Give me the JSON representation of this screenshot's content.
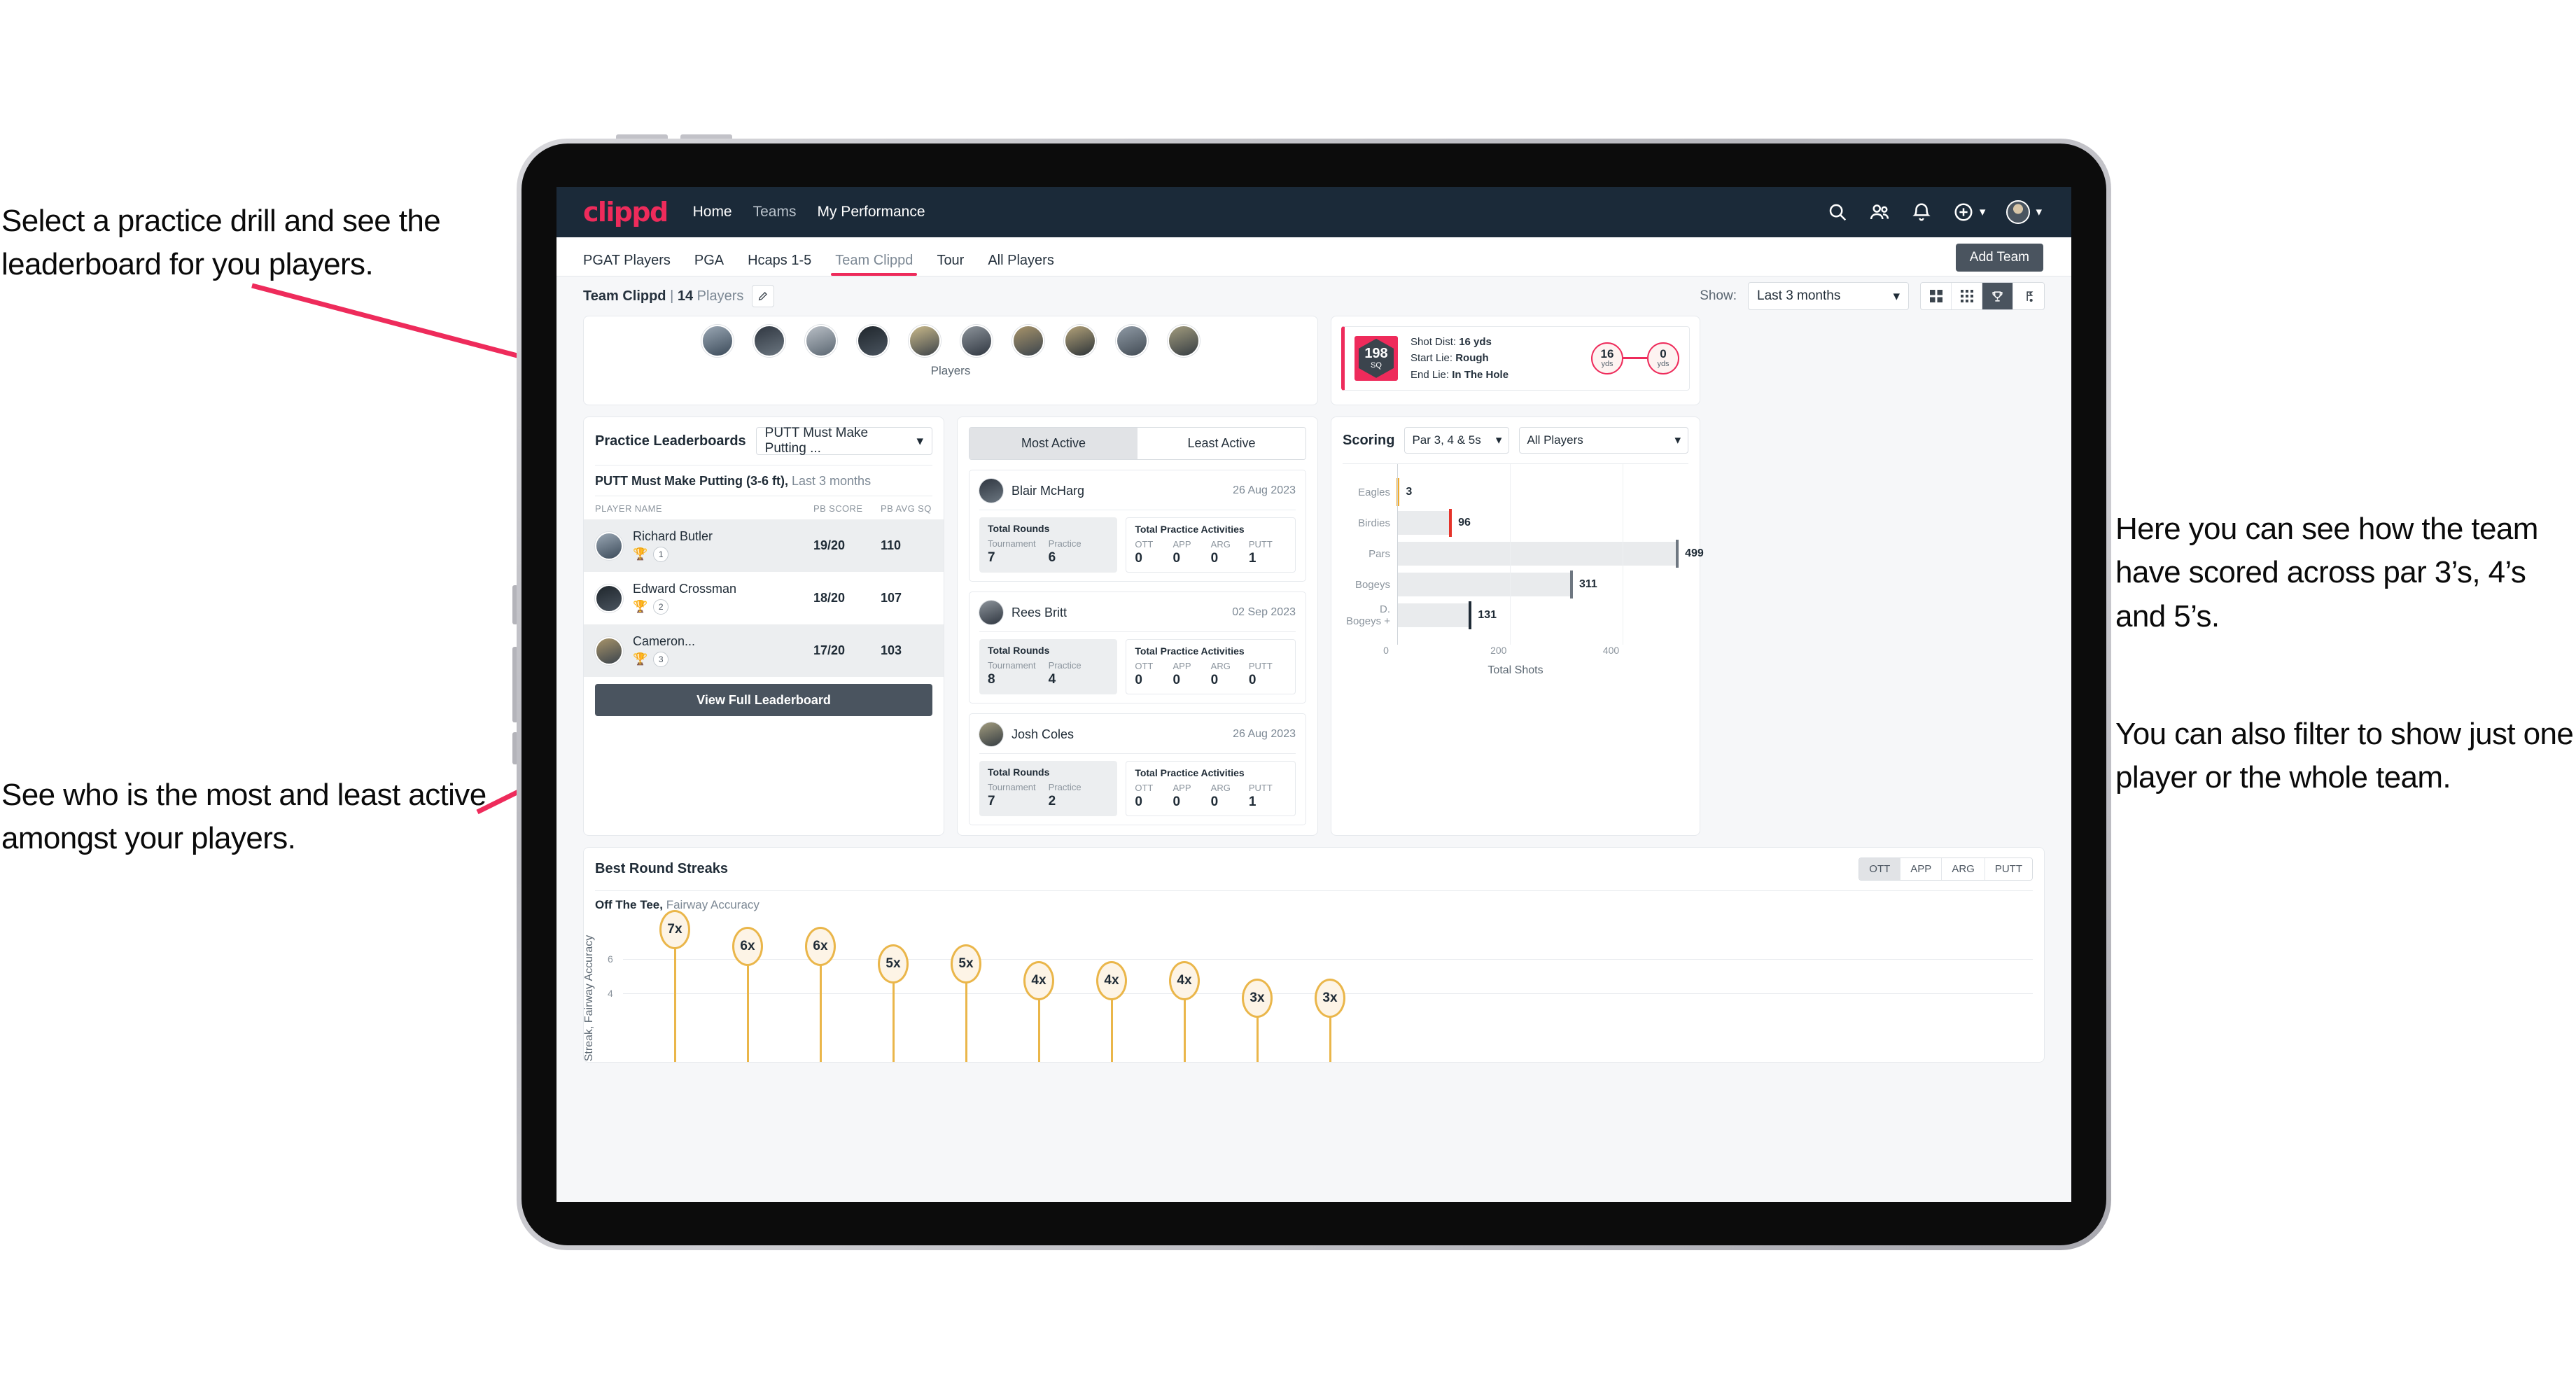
{
  "annotations": {
    "top_left": "Select a practice drill and see the leaderboard for you players.",
    "bottom_left": "See who is the most and least active amongst your players.",
    "right_1": "Here you can see how the team have scored across par 3’s, 4’s and 5’s.",
    "right_2": "You can also filter to show just one player or the whole team.",
    "arrow_color": "#ee2b5b"
  },
  "app": {
    "logo": "clippd",
    "brand_color": "#ee2b5b",
    "navbar_bg": "#1b2a39",
    "nav_links": [
      "Home",
      "Teams",
      "My Performance"
    ],
    "nav_icons": [
      "search-icon",
      "people-icon",
      "bell-icon",
      "plus-circle-icon",
      "avatar-icon"
    ]
  },
  "tabs": {
    "items": [
      "PGAT Players",
      "PGA",
      "Hcaps 1-5",
      "Team Clippd",
      "Tour",
      "All Players"
    ],
    "active": "Team Clippd",
    "add_team_label": "Add Team"
  },
  "subbar": {
    "team_name": "Team Clippd",
    "separator": "|",
    "player_count": "14",
    "players_word": "Players",
    "edit_icon": "pencil-icon",
    "show_label": "Show:",
    "show_value": "Last 3 months",
    "view_modes": [
      "grid-large-icon",
      "grid-small-icon",
      "trophy-icon",
      "flag-icon"
    ],
    "active_view": "trophy-icon"
  },
  "players_strip": {
    "label": "Players",
    "avatar_count": 10
  },
  "shot_card": {
    "sq_value": "198",
    "sq_unit": "SQ",
    "lines": [
      {
        "label": "Shot Dist:",
        "value": "16 yds"
      },
      {
        "label": "Start Lie:",
        "value": "Rough"
      },
      {
        "label": "End Lie:",
        "value": "In The Hole"
      }
    ],
    "start_yds": "16",
    "end_yds": "0",
    "yds_unit": "yds"
  },
  "leaderboard": {
    "title": "Practice Leaderboards",
    "drill_select": "PUTT Must Make Putting ...",
    "subtitle_bold": "PUTT Must Make Putting (3-6 ft),",
    "subtitle_rest": " Last 3 months",
    "columns": [
      "PLAYER NAME",
      "PB SCORE",
      "PB AVG SQ"
    ],
    "rows": [
      {
        "name": "Richard Butler",
        "rank": "1",
        "trophy": "gold",
        "pb_score": "19/20",
        "pb_avg_sq": "110"
      },
      {
        "name": "Edward Crossman",
        "rank": "2",
        "trophy": "silver",
        "pb_score": "18/20",
        "pb_avg_sq": "107"
      },
      {
        "name": "Cameron...",
        "rank": "3",
        "trophy": "bronze",
        "pb_score": "17/20",
        "pb_avg_sq": "103"
      }
    ],
    "view_full_label": "View Full Leaderboard"
  },
  "activity": {
    "tabs": [
      "Most Active",
      "Least Active"
    ],
    "active_tab": "Most Active",
    "rounds_title": "Total Rounds",
    "rounds_keys": [
      "Tournament",
      "Practice"
    ],
    "acts_title": "Total Practice Activities",
    "acts_keys": [
      "OTT",
      "APP",
      "ARG",
      "PUTT"
    ],
    "cards": [
      {
        "name": "Blair McHarg",
        "date": "26 Aug 2023",
        "rounds": [
          "7",
          "6"
        ],
        "acts": [
          "0",
          "0",
          "0",
          "1"
        ]
      },
      {
        "name": "Rees Britt",
        "date": "02 Sep 2023",
        "rounds": [
          "8",
          "4"
        ],
        "acts": [
          "0",
          "0",
          "0",
          "0"
        ]
      },
      {
        "name": "Josh Coles",
        "date": "26 Aug 2023",
        "rounds": [
          "7",
          "2"
        ],
        "acts": [
          "0",
          "0",
          "0",
          "1"
        ]
      }
    ]
  },
  "scoring": {
    "title": "Scoring",
    "par_select": "Par 3, 4 & 5s",
    "player_select": "All Players"
  },
  "streaks": {
    "title": "Best Round Streaks",
    "toggle": [
      "OTT",
      "APP",
      "ARG",
      "PUTT"
    ],
    "active_toggle": "OTT",
    "sub_bold": "Off The Tee,",
    "sub_rest": " Fairway Accuracy",
    "ylabel": "Streak, Fairway Accuracy",
    "yticks": [
      "6",
      "4"
    ]
  },
  "chart_data": [
    {
      "type": "bar",
      "orientation": "horizontal",
      "title": "Scoring",
      "categories": [
        "Eagles",
        "Birdies",
        "Pars",
        "Bogeys",
        "D. Bogeys +"
      ],
      "values": [
        3,
        96,
        499,
        311,
        131
      ],
      "bar_tip_colors": [
        "#f0ab2b",
        "#e5332a",
        "#6e7781",
        "#6e7781",
        "#1f2b36"
      ],
      "xlabel": "Total Shots",
      "ylabel": "",
      "xlim": [
        0,
        520
      ],
      "xticks": [
        0,
        200,
        400
      ],
      "grid": true,
      "legend": "none"
    },
    {
      "type": "scatter",
      "title": "Best Round Streaks",
      "subtitle": "Off The Tee, Fairway Accuracy",
      "ylabel": "Streak, Fairway Accuracy",
      "xlabel": "",
      "ylim": [
        0,
        8
      ],
      "yticks": [
        4,
        6
      ],
      "labels": [
        "7x",
        "6x",
        "6x",
        "5x",
        "5x",
        "4x",
        "4x",
        "4x",
        "3x",
        "3x"
      ],
      "values": [
        7,
        6,
        6,
        5,
        5,
        4,
        4,
        4,
        3,
        3
      ],
      "marker_color": "#eab64a",
      "marker_fill": "#fdf4e6",
      "grid": true
    }
  ]
}
